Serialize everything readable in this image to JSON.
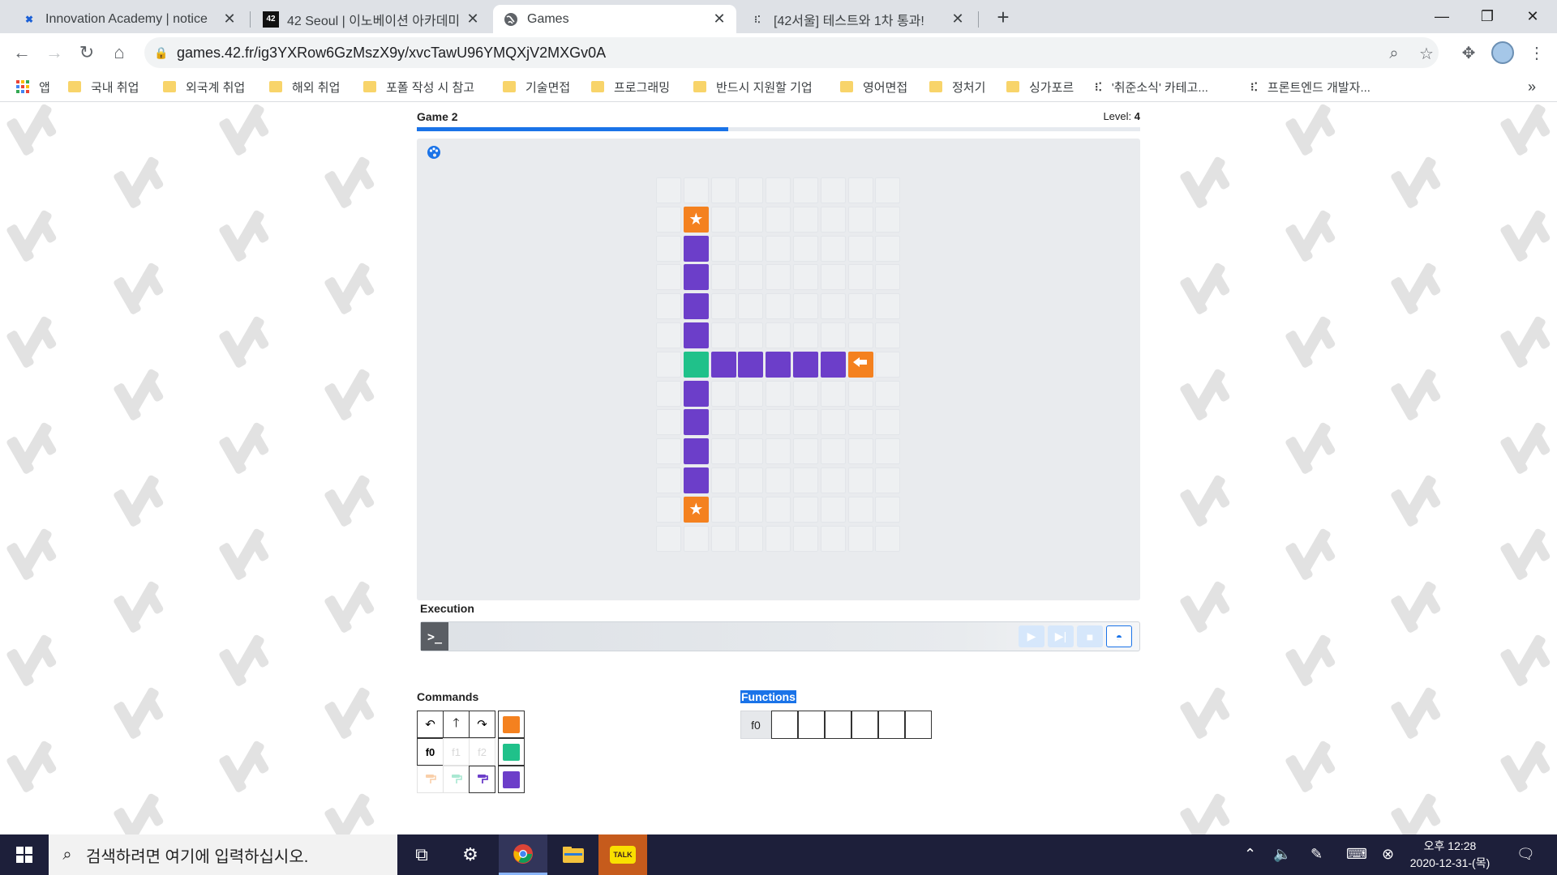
{
  "browser": {
    "tabs": [
      {
        "title": "Innovation Academy | notice",
        "icon": "innovation-academy-icon"
      },
      {
        "title": "42 Seoul | 이노베이션 아카데미",
        "icon": "42-icon"
      },
      {
        "title": "Games",
        "icon": "globe-icon",
        "active": true
      },
      {
        "title": "[42서울] 테스트와 1차 통과!",
        "icon": "dots-icon"
      }
    ],
    "close_glyph": "✕",
    "new_tab_glyph": "+",
    "url": "games.42.fr/ig3YXRow6GzMszX9y/xvcTawU96YMQXjV2MXGv0A",
    "bookmarks": [
      {
        "label": "앱",
        "kind": "apps"
      },
      {
        "label": "국내 취업",
        "kind": "folder"
      },
      {
        "label": "외국계 취업",
        "kind": "folder"
      },
      {
        "label": "해외 취업",
        "kind": "folder"
      },
      {
        "label": "포폴 작성 시 참고",
        "kind": "folder"
      },
      {
        "label": "기술면접",
        "kind": "folder"
      },
      {
        "label": "프로그래밍",
        "kind": "folder"
      },
      {
        "label": "반드시 지원할 기업",
        "kind": "folder"
      },
      {
        "label": "영어면접",
        "kind": "folder"
      },
      {
        "label": "정처기",
        "kind": "folder"
      },
      {
        "label": "싱가포르",
        "kind": "folder"
      },
      {
        "label": "'취준소식' 카테고...",
        "kind": "site"
      },
      {
        "label": "프론트엔드 개발자...",
        "kind": "site"
      }
    ],
    "more_bookmarks_glyph": "»"
  },
  "game": {
    "title": "Game 2",
    "level_label": "Level:",
    "level_value": "4",
    "progress_fraction": 0.43,
    "grid": {
      "cols": 9,
      "rows": 13,
      "cells": [
        {
          "c": 1,
          "r": 1,
          "color": "orange",
          "icon": "star"
        },
        {
          "c": 1,
          "r": 2,
          "color": "purple"
        },
        {
          "c": 1,
          "r": 3,
          "color": "purple"
        },
        {
          "c": 1,
          "r": 4,
          "color": "purple"
        },
        {
          "c": 1,
          "r": 5,
          "color": "purple"
        },
        {
          "c": 1,
          "r": 6,
          "color": "teal"
        },
        {
          "c": 2,
          "r": 6,
          "color": "purple"
        },
        {
          "c": 3,
          "r": 6,
          "color": "purple"
        },
        {
          "c": 4,
          "r": 6,
          "color": "purple"
        },
        {
          "c": 5,
          "r": 6,
          "color": "purple"
        },
        {
          "c": 6,
          "r": 6,
          "color": "purple"
        },
        {
          "c": 7,
          "r": 6,
          "color": "orange",
          "icon": "ship"
        },
        {
          "c": 1,
          "r": 7,
          "color": "purple"
        },
        {
          "c": 1,
          "r": 8,
          "color": "purple"
        },
        {
          "c": 1,
          "r": 9,
          "color": "purple"
        },
        {
          "c": 1,
          "r": 10,
          "color": "purple"
        },
        {
          "c": 1,
          "r": 11,
          "color": "orange",
          "icon": "star"
        }
      ]
    },
    "execution_label": "Execution",
    "prompt_glyph": ">_",
    "commands_label": "Commands",
    "commands": {
      "rotate_left": "↶",
      "forward": "🡑",
      "rotate_right": "↷",
      "f0": "f0",
      "f1": "f1",
      "f2": "f2"
    },
    "functions_label": "Functions",
    "f0_label": "f0",
    "f0_slots": 6
  },
  "colors": {
    "orange": "#f4811f",
    "teal": "#20c18a",
    "purple": "#6c3ec9",
    "accent": "#1a73e8"
  },
  "taskbar": {
    "search_placeholder": "검색하려면 여기에 입력하십시오.",
    "clock_time": "오후 12:28",
    "clock_date": "2020-12-31-(목)"
  }
}
